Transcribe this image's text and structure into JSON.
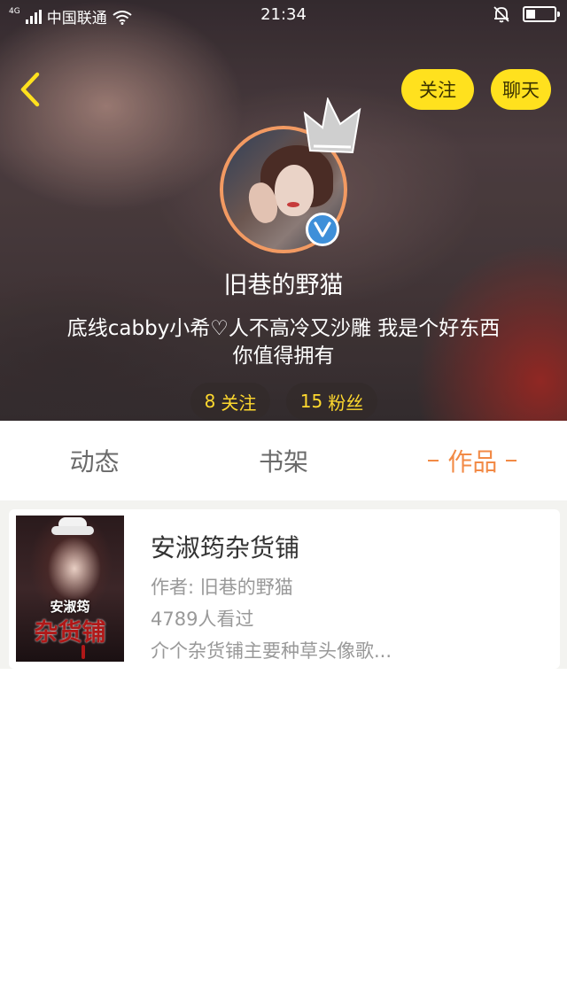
{
  "status_bar": {
    "network": "4G",
    "carrier": "中国联通",
    "time": "21:34"
  },
  "header": {
    "follow_label": "关注",
    "chat_label": "聊天"
  },
  "profile": {
    "username": "旧巷的野猫",
    "bio_line1": "底线cabby小希♡人不高冷又沙雕 我是个好东西",
    "bio_line2": "你值得拥有",
    "verified_badge": "V",
    "following_count": "8",
    "following_label": "关注",
    "fans_count": "15",
    "fans_label": "粉丝"
  },
  "tabs": [
    {
      "label": "动态",
      "active": false
    },
    {
      "label": "书架",
      "active": false
    },
    {
      "label": "作品",
      "active": true
    }
  ],
  "works": [
    {
      "title": "安淑筠杂货铺",
      "author": "作者: 旧巷的野猫",
      "views": "4789人看过",
      "description": "介个杂货铺主要种草头像歌...",
      "cover_title_top": "安淑筠",
      "cover_title_bottom": "杂货铺"
    }
  ],
  "colors": {
    "accent_yellow": "#ffe11e",
    "stat_text": "#ffd92e",
    "active_tab": "#f28a46",
    "avatar_ring": "#f29a62",
    "verified_blue": "#3e8fd9"
  },
  "icons": [
    "signal-icon",
    "wifi-icon",
    "bell-muted-icon",
    "battery-icon",
    "back-chevron-icon",
    "crown-icon",
    "verified-icon"
  ]
}
